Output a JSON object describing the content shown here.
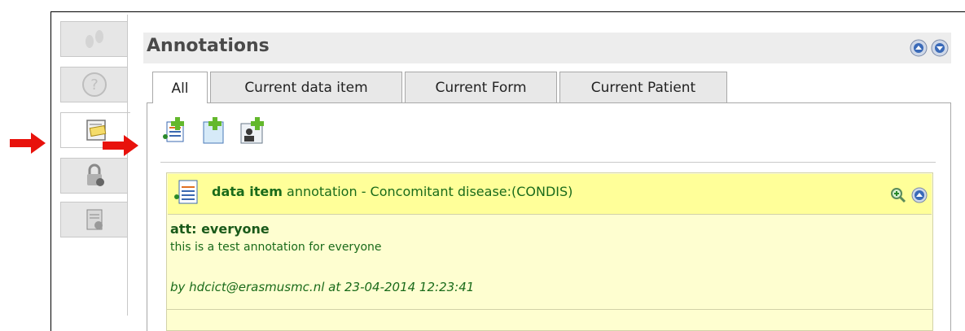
{
  "panel": {
    "title": "Annotations"
  },
  "tabs": [
    {
      "label": "All",
      "active": true
    },
    {
      "label": "Current data item",
      "active": false
    },
    {
      "label": "Current Form",
      "active": false
    },
    {
      "label": "Current Patient",
      "active": false
    }
  ],
  "sidebar": {
    "items": [
      {
        "icon": "footsteps-icon"
      },
      {
        "icon": "help-icon"
      },
      {
        "icon": "annotation-icon",
        "active": true
      },
      {
        "icon": "lock-icon"
      },
      {
        "icon": "report-icon"
      }
    ]
  },
  "toolbar": {
    "icons": [
      "add-annotation-icon",
      "add-note-icon",
      "add-patient-annotation-icon"
    ]
  },
  "annotation": {
    "type_label": "data item",
    "header_rest": " annotation - Concomitant disease:(CONDIS)",
    "att": "att: everyone",
    "body": "this is a test annotation for everyone",
    "author": "by hdcict@erasmusmc.nl at 23-04-2014 12:23:41"
  },
  "colors": {
    "arrow": "#e8120c",
    "card_header": "#ffff99",
    "card_body": "#fefed0",
    "text_green": "#1a6b1a"
  }
}
